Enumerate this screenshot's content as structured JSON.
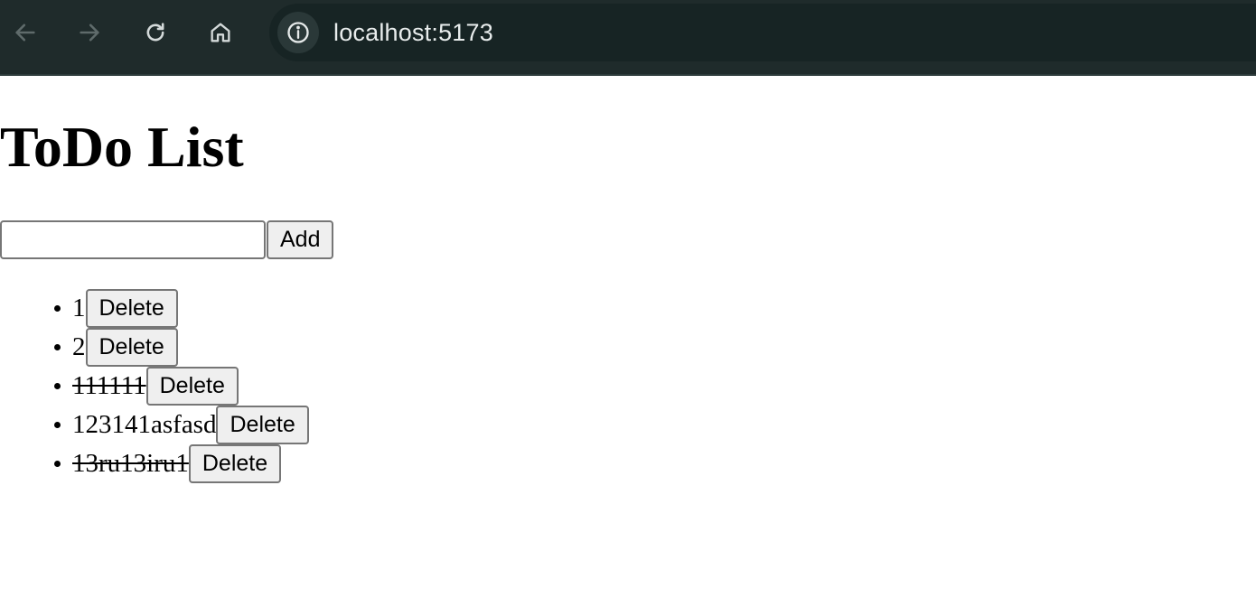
{
  "browser": {
    "url": "localhost:5173",
    "icons": {
      "back": "arrow-left-icon",
      "forward": "arrow-right-icon",
      "reload": "reload-icon",
      "home": "home-icon",
      "site_info": "info-icon"
    }
  },
  "page": {
    "title": "ToDo List",
    "input": {
      "value": "",
      "placeholder": ""
    },
    "add_label": "Add",
    "todos": [
      {
        "text": "1",
        "completed": false,
        "delete_label": "Delete"
      },
      {
        "text": "2",
        "completed": false,
        "delete_label": "Delete"
      },
      {
        "text": "111111",
        "completed": true,
        "delete_label": "Delete"
      },
      {
        "text": "123141asfasd",
        "completed": false,
        "delete_label": "Delete"
      },
      {
        "text": "13ru13iru1",
        "completed": true,
        "delete_label": "Delete"
      }
    ]
  }
}
